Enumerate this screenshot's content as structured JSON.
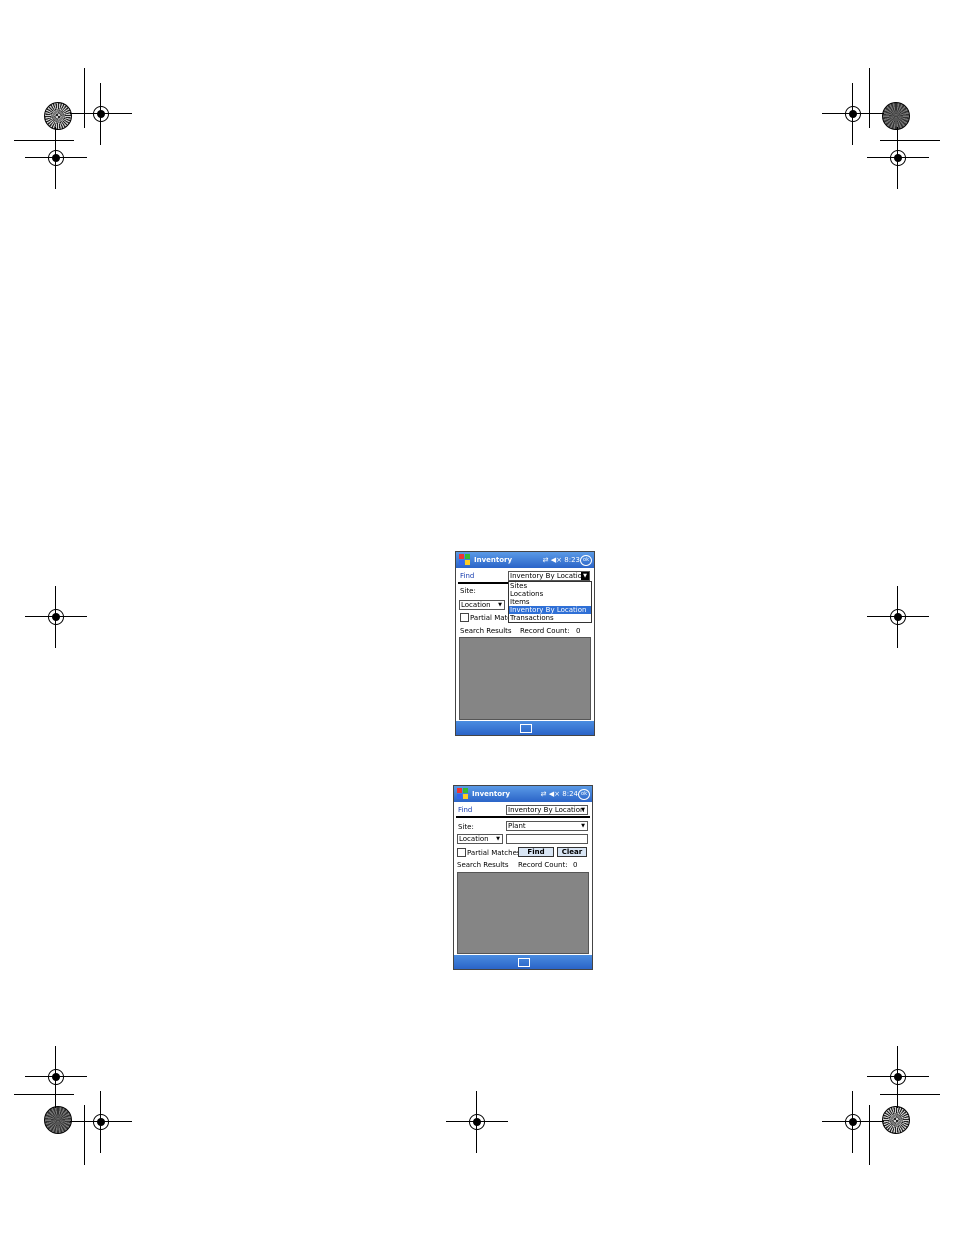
{
  "screen1": {
    "title": "Inventory",
    "time": "8:23",
    "ok": "ok",
    "menu_label": "Find",
    "view_select": "Inventory By Location",
    "dropdown_options": [
      "Sites",
      "Locations",
      "Items",
      "Inventory By Location",
      "Transactions"
    ],
    "site_label": "Site:",
    "location_select": "Location",
    "partial_label": "Partial Match",
    "search_results_label": "Search Results",
    "record_count_label": "Record Count:",
    "record_count": "0"
  },
  "screen2": {
    "title": "Inventory",
    "time": "8:24",
    "ok": "ok",
    "menu_label": "Find",
    "view_select": "Inventory By Location",
    "site_label": "Site:",
    "site_value": "Plant",
    "location_select": "Location",
    "location_input": "",
    "partial_label": "Partial Matches",
    "find_button": "Find",
    "clear_button": "Clear",
    "search_results_label": "Search Results",
    "record_count_label": "Record Count:",
    "record_count": "0"
  },
  "colors": {
    "titlebar": "#2a64c8",
    "results_panel": "#858585",
    "selection": "#2e6fd6"
  }
}
